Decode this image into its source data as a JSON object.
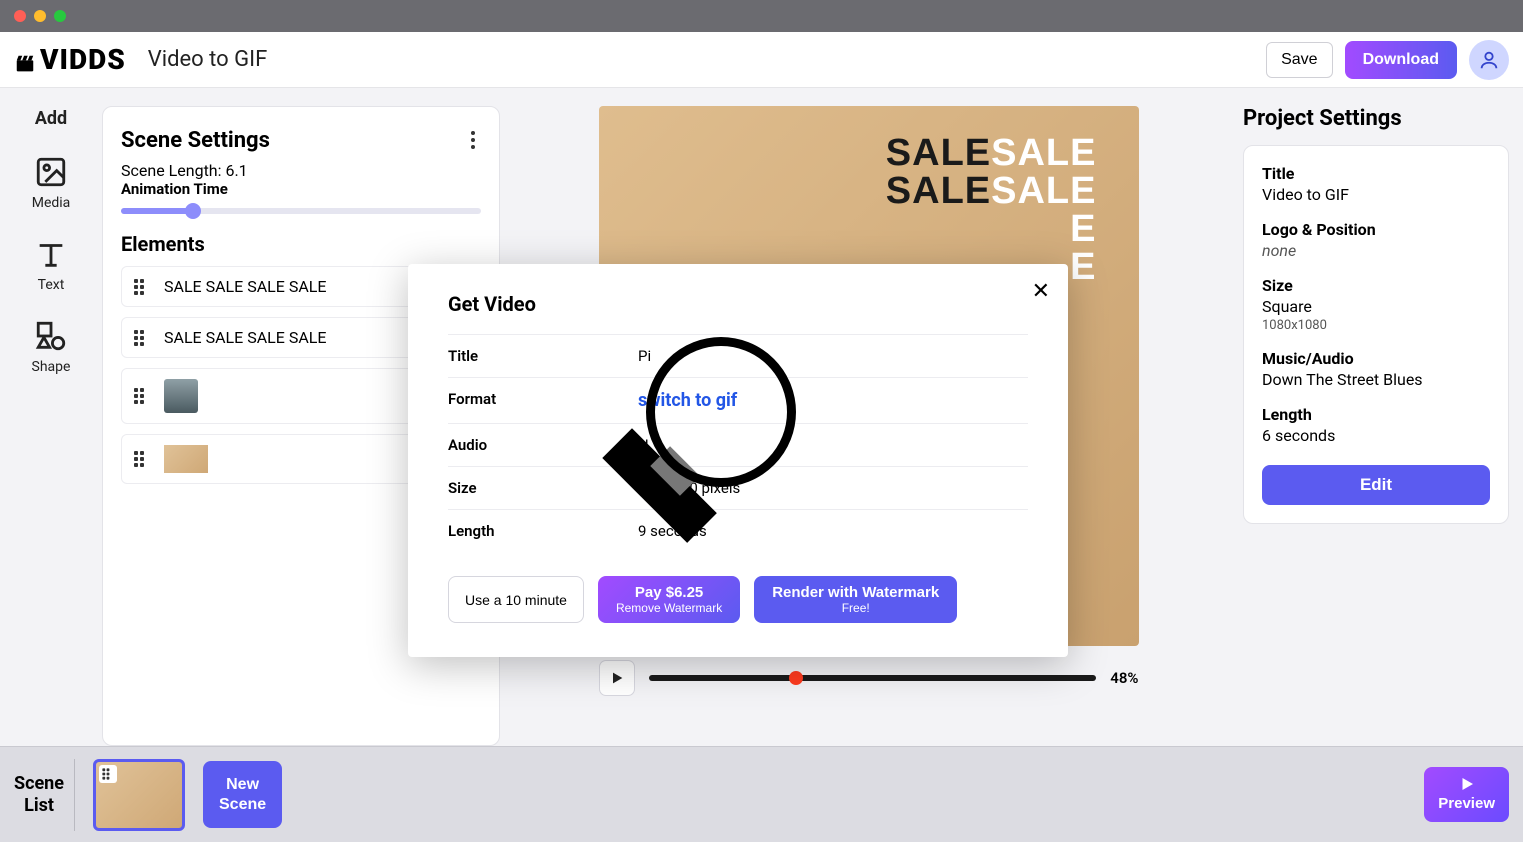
{
  "header": {
    "brand": "VIDDS",
    "page_title": "Video to GIF",
    "save": "Save",
    "download": "Download"
  },
  "sidenav": {
    "add": "Add",
    "media": "Media",
    "text": "Text",
    "shape": "Shape"
  },
  "scene_panel": {
    "title": "Scene Settings",
    "scene_length_label": "Scene Length: 6.1",
    "animation_time_label": "Animation Time",
    "elements_title": "Elements",
    "elements": [
      {
        "type": "text",
        "label": "SALE SALE SALE SALE"
      },
      {
        "type": "text",
        "label": "SALE SALE SALE SALE"
      },
      {
        "type": "image",
        "label": ""
      },
      {
        "type": "image",
        "label": ""
      }
    ]
  },
  "canvas": {
    "text_rows": [
      [
        "SALE",
        "SALE"
      ],
      [
        "SALE",
        "SALE"
      ],
      [
        "E"
      ],
      [
        "E"
      ]
    ]
  },
  "playbar": {
    "percent": "48%"
  },
  "project": {
    "panel_title": "Project Settings",
    "title_label": "Title",
    "title_value": "Video to GIF",
    "logo_label": "Logo & Position",
    "logo_value": "none",
    "size_label": "Size",
    "size_value": "Square",
    "size_sub": "1080x1080",
    "music_label": "Music/Audio",
    "music_value": "Down The Street Blues",
    "length_label": "Length",
    "length_value": "6 seconds",
    "edit": "Edit"
  },
  "bottombar": {
    "scene_list": "Scene\nList",
    "new_scene": "New\nScene",
    "preview": "Preview"
  },
  "modal": {
    "title": "Get Video",
    "rows": {
      "title_label": "Title",
      "title_value": "Pi",
      "format_label": "Format",
      "switch_link": "switch to gif",
      "audio_label": "Audio",
      "audio_value": "N",
      "size_label": "Size",
      "size_value": "500 pixels",
      "size_prefix": "5",
      "length_label": "Length",
      "length_value": "9 seconds"
    },
    "trial": "Use a 10 minute",
    "pay_top": "Pay $6.25",
    "pay_bot": "Remove Watermark",
    "render_top": "Render with Watermark",
    "render_bot": "Free!"
  }
}
